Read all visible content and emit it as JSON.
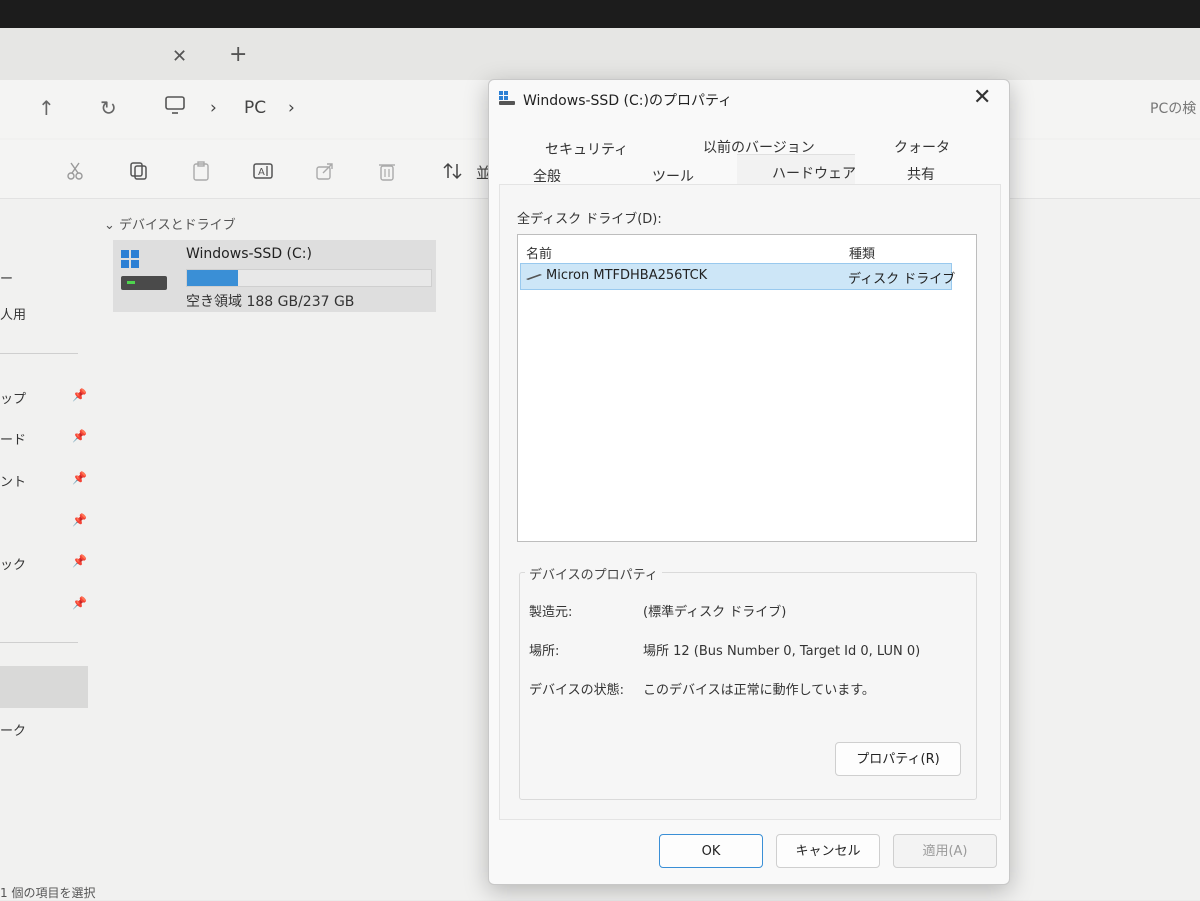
{
  "explorer": {
    "breadcrumb": [
      "PC"
    ],
    "search_placeholder": "PCの検",
    "sort_label": "並",
    "group_header": "デバイスとドライブ",
    "drive": {
      "name": "Windows-SSD (C:)",
      "free_text": "空き領域 188 GB/237 GB",
      "used_fraction": 0.21,
      "bar_color": "#3a8fd6"
    },
    "sidebar_items": [
      "ー",
      "人用",
      "ップ",
      "ード",
      "ント",
      "",
      "ック",
      "",
      "ーク"
    ],
    "status_text": "1 個の項目を選択"
  },
  "dialog": {
    "title": "Windows-SSD (C:)のプロパティ",
    "tabs_top": [
      "セキュリティ",
      "以前のバージョン",
      "クォータ"
    ],
    "tabs_bottom": [
      "全般",
      "ツール",
      "ハードウェア",
      "共有"
    ],
    "list_label": "全ディスク ドライブ(D):",
    "columns": {
      "name": "名前",
      "type": "種類"
    },
    "rows": [
      {
        "name": "Micron MTFDHBA256TCK",
        "type": "ディスク ドライブ"
      }
    ],
    "group_title": "デバイスのプロパティ",
    "props": {
      "manufacturer_label": "製造元:",
      "manufacturer_value": "(標準ディスク ドライブ)",
      "location_label": "場所:",
      "location_value": "場所 12 (Bus Number 0, Target Id 0, LUN 0)",
      "status_label": "デバイスの状態:",
      "status_value": "このデバイスは正常に動作しています。"
    },
    "properties_button": "プロパティ(R)",
    "ok": "OK",
    "cancel": "キャンセル",
    "apply": "適用(A)",
    "accent_color": "#3a8fd6"
  }
}
